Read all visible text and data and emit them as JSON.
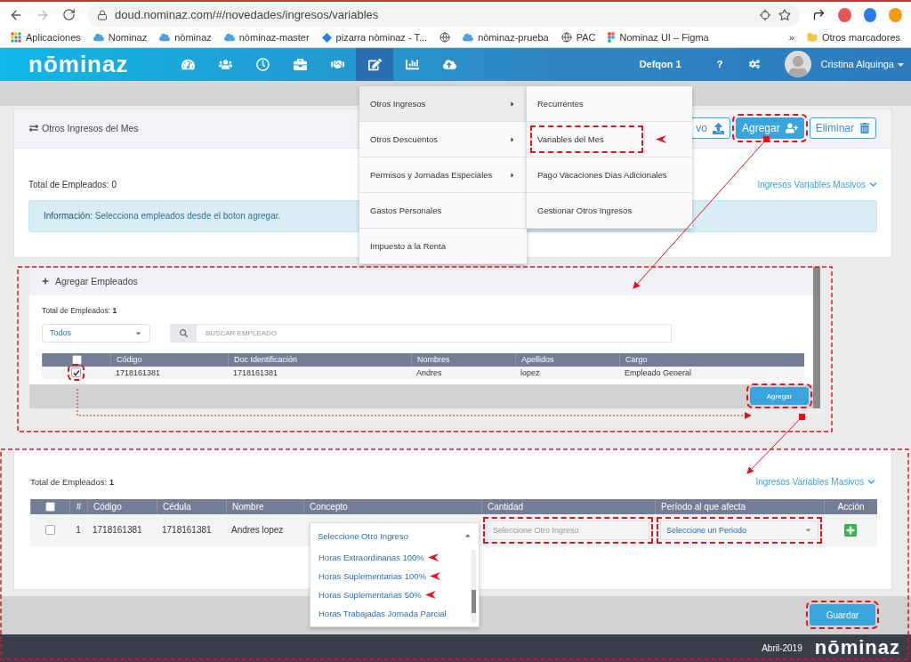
{
  "browser": {
    "url": "doud.nominaz.com/#/novedades/ingresos/variables",
    "bookmarks": [
      {
        "label": "Aplicaciones",
        "kind": "apps"
      },
      {
        "label": "Nominaz",
        "kind": "cloud"
      },
      {
        "label": "nòminaz",
        "kind": "cloud"
      },
      {
        "label": "nòminaz-master",
        "kind": "cloud"
      },
      {
        "label": "pizarra nòminaz - T...",
        "kind": "diamond"
      },
      {
        "kind": "globe"
      },
      {
        "label": "nòminaz-prueba",
        "kind": "cloud"
      },
      {
        "label": "PAC",
        "kind": "globe"
      },
      {
        "label": "Nominaz UI – Figma",
        "kind": "figma"
      }
    ],
    "more": "»",
    "other_bookmarks": "Otros marcadores"
  },
  "navbar": {
    "logo": "nōmin",
    "logo_accent": "az",
    "items": [
      {
        "kind": "dashboard",
        "selected": false
      },
      {
        "kind": "users",
        "selected": false
      },
      {
        "kind": "clock",
        "selected": false
      },
      {
        "kind": "briefcase",
        "selected": false
      },
      {
        "kind": "handshake",
        "selected": false
      },
      {
        "kind": "edit",
        "selected": true
      },
      {
        "kind": "chart",
        "selected": false
      },
      {
        "kind": "upload",
        "selected": false
      }
    ],
    "company": "Defqon 1",
    "help": "?",
    "user": "Cristina Alquinga"
  },
  "menu": {
    "items": [
      {
        "label": "Otros Ingresos",
        "submenu": true,
        "selected": true
      },
      {
        "label": "Otros Descuentos",
        "submenu": true,
        "selected": false
      },
      {
        "label": "Permisos y Jornadas Especiales",
        "submenu": true,
        "selected": false
      },
      {
        "label": "Gastos Personales",
        "submenu": false,
        "selected": false
      },
      {
        "label": "Impuesto a la Renta",
        "submenu": false,
        "selected": false
      }
    ],
    "submenu": [
      {
        "label": "Recurrentes",
        "highlighted": false,
        "pointer": false
      },
      {
        "label": "Variables del Mes",
        "highlighted": true,
        "pointer": true
      },
      {
        "label": "Pago Vacaciones Dias Adicionales",
        "highlighted": false,
        "pointer": false
      },
      {
        "label": "Gestionar Otros Ingresos",
        "highlighted": false,
        "pointer": false
      }
    ]
  },
  "main_card": {
    "title": "Otros Ingresos del Mes",
    "buttons": [
      {
        "label": "vo",
        "kind": "upload"
      },
      {
        "label": "Agregar",
        "kind": "add",
        "highlighted": true
      },
      {
        "label": "Eliminar",
        "kind": "delete"
      }
    ],
    "total_label": "Total de Empleados:",
    "total": "0",
    "link": "Ingresos Variables Masivos",
    "info_label": "Información:",
    "info_text": "Selecciona empleados desde el boton agregar."
  },
  "add_panel": {
    "title": "Agregar Empleados",
    "total_label": "Total de Empleados:",
    "total": "1",
    "filter": "Todos",
    "search_placeholder": "BUSCAR EMPLEADO",
    "select_all": false,
    "columns": [
      "Código",
      "Doc Identificación",
      "Nombres",
      "Apellidos",
      "Cargo"
    ],
    "rows": [
      {
        "checked": true,
        "cells": [
          "1718161381",
          "1718161381",
          "Andres",
          "lopez",
          "Empleado General"
        ]
      }
    ],
    "button": "Agregar"
  },
  "result_card": {
    "total_label": "Total de Empleados:",
    "total": "1",
    "link": "Ingresos Variables Masivos",
    "select_all": false,
    "columns": [
      "#",
      "Código",
      "Cédula",
      "Nombre",
      "Concepto",
      "Cantidad",
      "Período al que afecta",
      "Acción"
    ],
    "rows": [
      {
        "checked": false,
        "cells": [
          "1",
          "1718161381",
          "1718161381",
          "Andres lopez"
        ],
        "concept_placeholder": "Seleccione Otro Ingreso",
        "quantity_placeholder": "Seleccione Otro Ingreso",
        "period_placeholder": "Seleccione un Periodo"
      }
    ],
    "options": [
      {
        "label": "Horas Extraordinarias 100%",
        "pointer": true
      },
      {
        "label": "Horas Suplementarias 100%",
        "pointer": true
      },
      {
        "label": "Horas Suplementarias 50%",
        "pointer": true
      },
      {
        "label": "Horas Trabajadas Jornada Parcial",
        "pointer": false
      }
    ],
    "save": "Guardar"
  },
  "footer": {
    "date": "Abril-2019",
    "logo": "nōmin",
    "logo_accent": "az"
  }
}
